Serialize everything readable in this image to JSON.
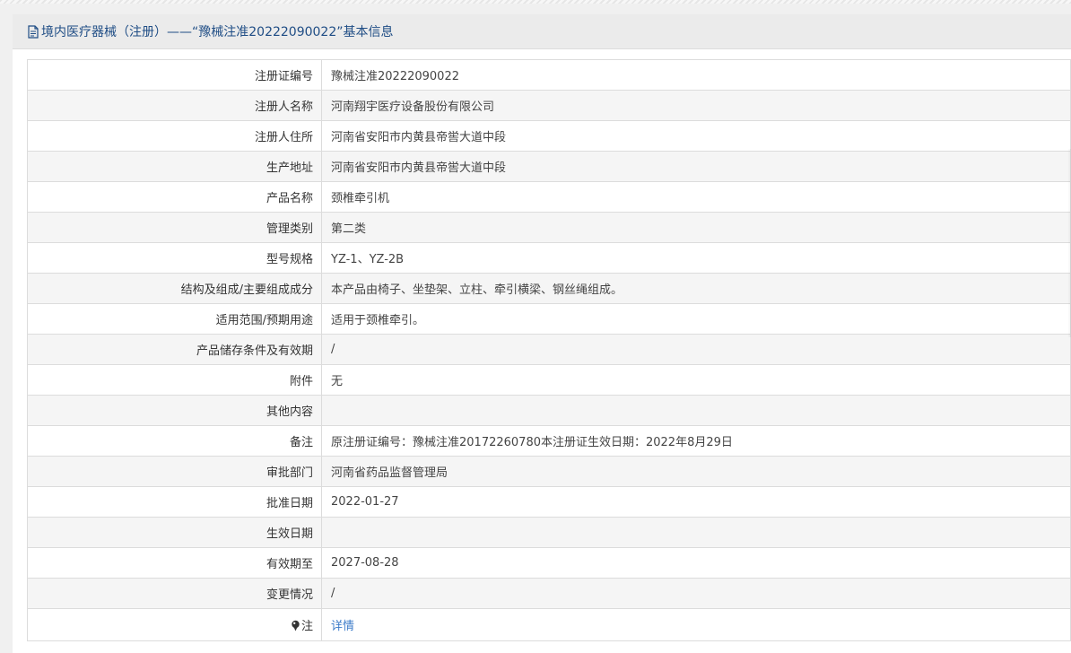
{
  "header": {
    "title": "境内医疗器械（注册）——“豫械注准20222090022”基本信息",
    "icon": "document-icon"
  },
  "rows": [
    {
      "label": "注册证编号",
      "value": "豫械注准20222090022"
    },
    {
      "label": "注册人名称",
      "value": "河南翔宇医疗设备股份有限公司"
    },
    {
      "label": "注册人住所",
      "value": "河南省安阳市内黄县帝喾大道中段"
    },
    {
      "label": "生产地址",
      "value": "河南省安阳市内黄县帝喾大道中段"
    },
    {
      "label": "产品名称",
      "value": "颈椎牵引机"
    },
    {
      "label": "管理类别",
      "value": "第二类"
    },
    {
      "label": "型号规格",
      "value": "YZ-1、YZ-2B"
    },
    {
      "label": "结构及组成/主要组成成分",
      "value": "本产品由椅子、坐垫架、立柱、牵引横梁、钢丝绳组成。"
    },
    {
      "label": "适用范围/预期用途",
      "value": "适用于颈椎牵引。"
    },
    {
      "label": "产品储存条件及有效期",
      "value": "/"
    },
    {
      "label": "附件",
      "value": "无"
    },
    {
      "label": "其他内容",
      "value": ""
    },
    {
      "label": "备注",
      "value": "原注册证编号：豫械注准20172260780本注册证生效日期：2022年8月29日"
    },
    {
      "label": "审批部门",
      "value": "河南省药品监督管理局"
    },
    {
      "label": "批准日期",
      "value": "2022-01-27"
    },
    {
      "label": "生效日期",
      "value": ""
    },
    {
      "label": "有效期至",
      "value": "2027-08-28"
    },
    {
      "label": "变更情况",
      "value": "/"
    }
  ],
  "note_row": {
    "label": "注",
    "icon": "pin-icon",
    "link_text": "详情"
  },
  "colors": {
    "header_text": "#1f4d85",
    "link": "#3d7cc9",
    "border": "#dcdcdc",
    "stripe": "#f5f5f5"
  }
}
